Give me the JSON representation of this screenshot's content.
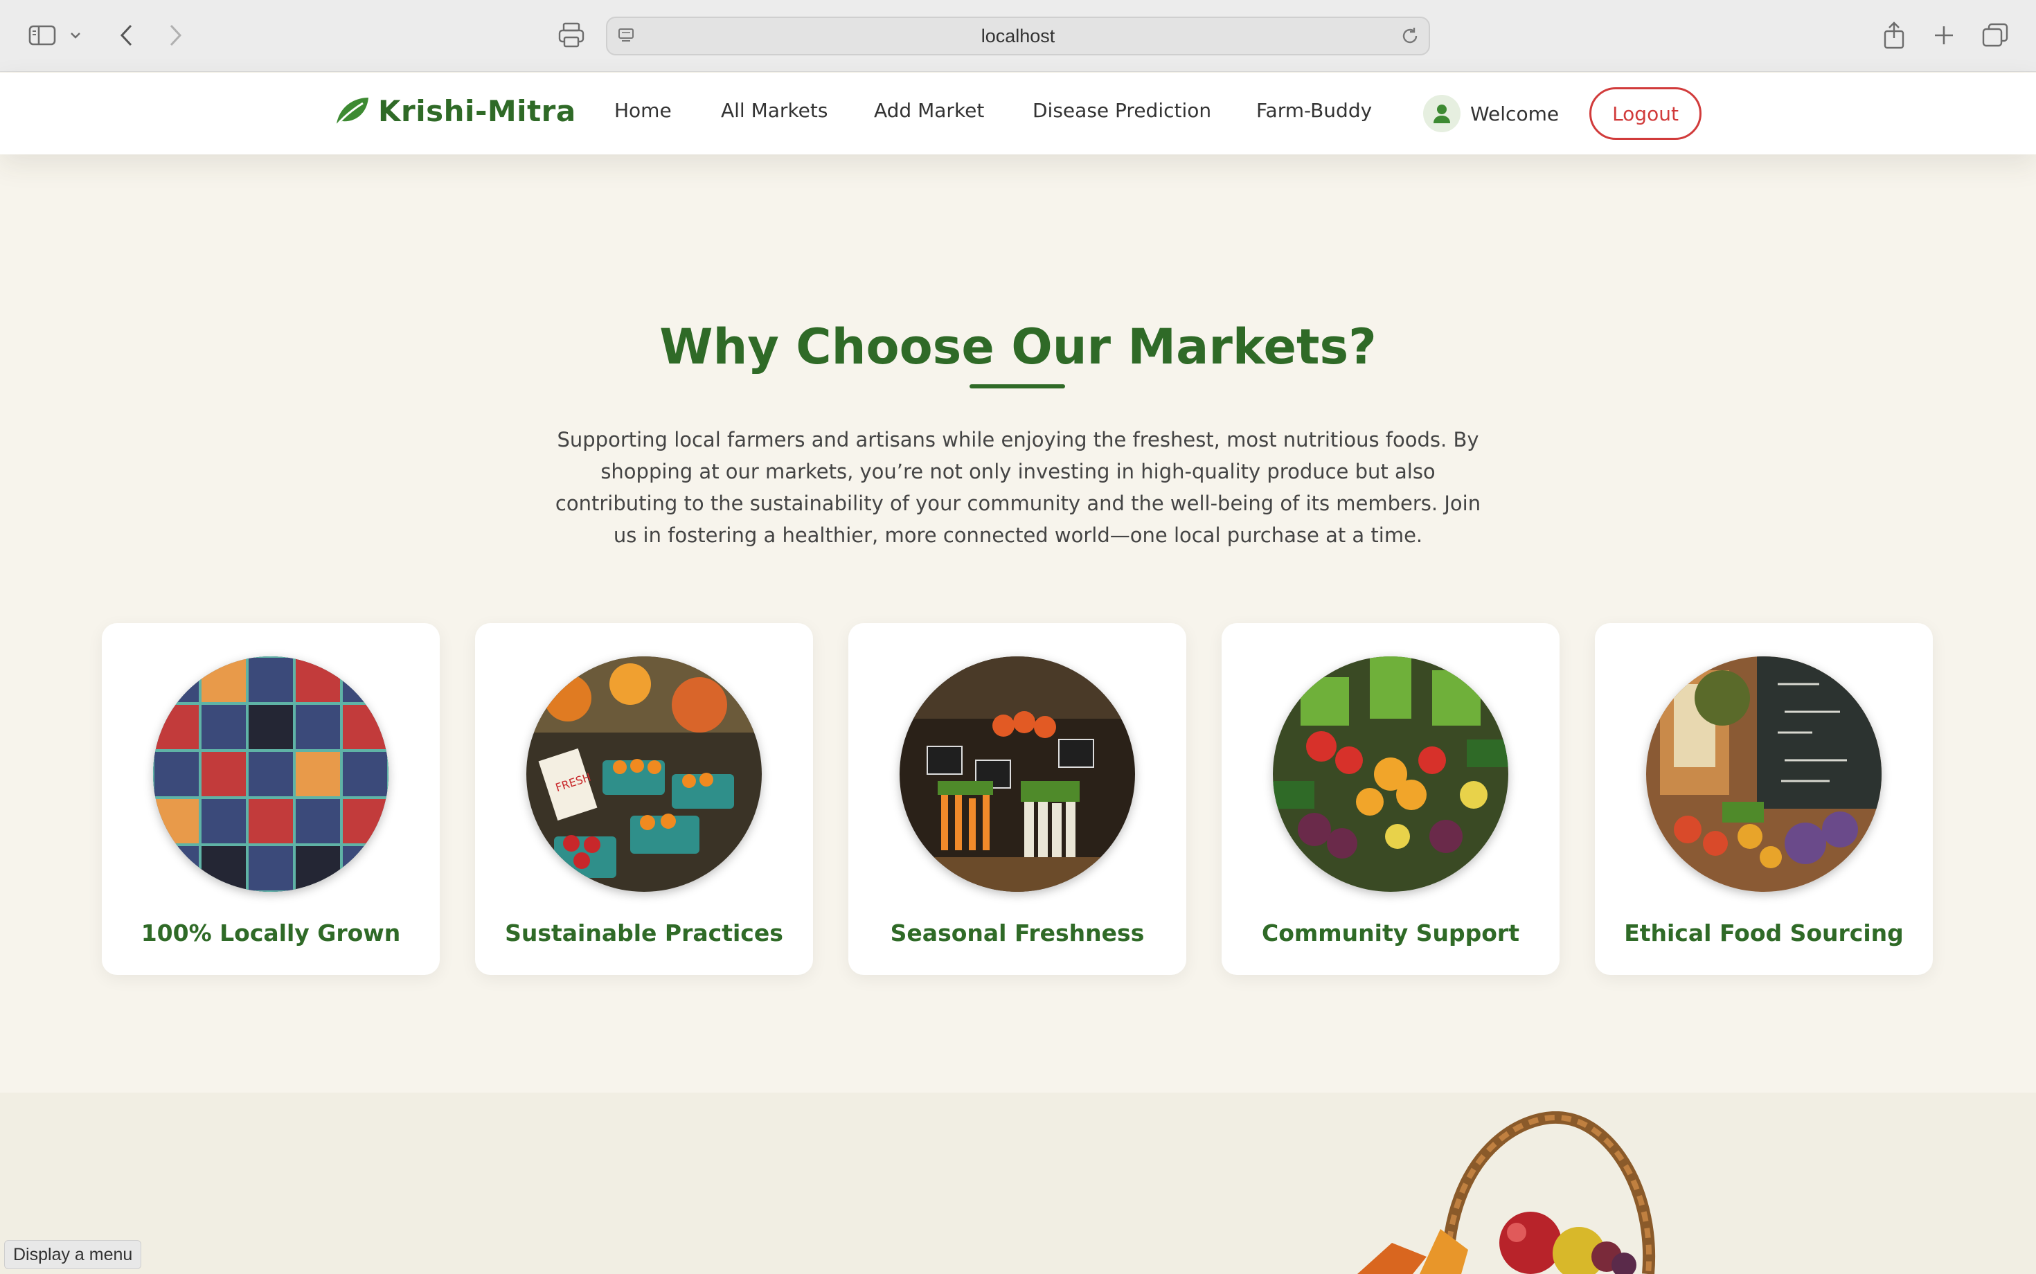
{
  "browser": {
    "url": "localhost",
    "status_text": "Display a menu"
  },
  "header": {
    "brand": "Krishi-Mitra",
    "nav": [
      "Home",
      "All Markets",
      "Add Market",
      "Disease Prediction",
      "Farm-Buddy"
    ],
    "welcome": "Welcome",
    "logout": "Logout"
  },
  "section": {
    "title": "Why Choose Our Markets?",
    "intro": "Supporting local farmers and artisans while enjoying the freshest, most nutritious foods. By shopping at our markets, you’re not only investing in high-quality produce but also contributing to the sustainability of your community and the well-being of its members. Join us in fostering a healthier, more connected world—one local purchase at a time.",
    "cards": [
      {
        "label": "100% Locally Grown",
        "image": "berry-baskets-photo"
      },
      {
        "label": "Sustainable Practices",
        "image": "produce-stall-photo"
      },
      {
        "label": "Seasonal Freshness",
        "image": "vegetable-stand-photo"
      },
      {
        "label": "Community Support",
        "image": "vegetable-display-photo"
      },
      {
        "label": "Ethical Food Sourcing",
        "image": "farm-store-photo"
      }
    ]
  },
  "colors": {
    "brand_green": "#2f6a27",
    "logout_red": "#d13b3b",
    "page_bg": "#f7f4ec"
  }
}
